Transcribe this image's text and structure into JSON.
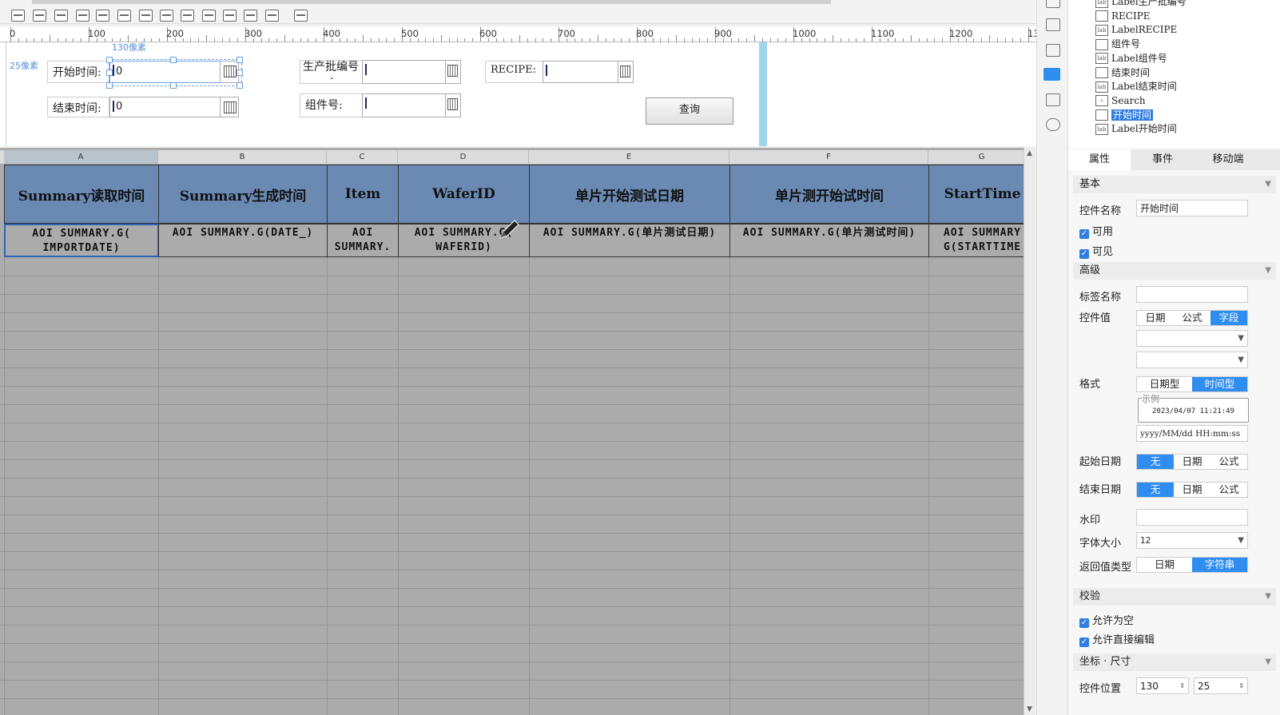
{
  "ruler": {
    "labels": [
      "0",
      "100",
      "200",
      "300",
      "400",
      "500",
      "600",
      "700",
      "800",
      "900",
      "1000",
      "1100",
      "1200",
      "13"
    ]
  },
  "canvas": {
    "hint_x": "130像素",
    "hint_y": "25像素",
    "start_label": "开始时间:",
    "start_value": "0",
    "end_label": "结束时间:",
    "end_value": "0",
    "batch_label": "生产批编号",
    "batch_dot": "·",
    "part_label": "组件号:",
    "recipe_label": "RECIPE:",
    "query_button": "查询"
  },
  "sheet": {
    "columns": [
      {
        "letter": "A",
        "header": "Summary读取时间",
        "cell": "AOI SUMMARY.G( IMPORTDATE)"
      },
      {
        "letter": "B",
        "header": "Summary生成时间",
        "cell": "AOI SUMMARY.G(DATE_)"
      },
      {
        "letter": "C",
        "header": "Item",
        "cell": "AOI SUMMARY."
      },
      {
        "letter": "D",
        "header": "WaferID",
        "cell": "AOI SUMMARY.G( WAFERID)"
      },
      {
        "letter": "E",
        "header": "单片开始测试日期",
        "cell": "AOI SUMMARY.G(单片测试日期)"
      },
      {
        "letter": "F",
        "header": "单片测开始试时间",
        "cell": "AOI SUMMARY.G(单片测试时间)"
      },
      {
        "letter": "G",
        "header": "StartTime",
        "cell": "AOI SUMMARY G(STARTTIME"
      }
    ],
    "splitter": "···"
  },
  "tree": {
    "nodes": [
      {
        "label": "Label生产批编号",
        "icon": "lab"
      },
      {
        "label": "RECIPE",
        "icon": "input"
      },
      {
        "label": "LabelRECIPE",
        "icon": "lab"
      },
      {
        "label": "组件号",
        "icon": "input"
      },
      {
        "label": "Label组件号",
        "icon": "lab"
      },
      {
        "label": "结束时间",
        "icon": "date"
      },
      {
        "label": "Label结束时间",
        "icon": "lab"
      },
      {
        "label": "Search",
        "icon": "search"
      },
      {
        "label": "开始时间",
        "icon": "date",
        "selected": true
      },
      {
        "label": "Label开始时间",
        "icon": "lab"
      }
    ]
  },
  "props": {
    "tabs": [
      "属性",
      "事件",
      "移动端"
    ],
    "sec_basic": "基本",
    "name_label": "控件名称",
    "name_value": "开始时间",
    "enabled": "可用",
    "visible": "可见",
    "sec_advanced": "高级",
    "tag_label": "标签名称",
    "value_label": "控件值",
    "value_modes": [
      "日期",
      "公式",
      "字段"
    ],
    "format_label": "格式",
    "format_modes": [
      "日期型",
      "时间型"
    ],
    "example_title": "示例",
    "example_value": "2023/04/07 11:21:49",
    "format_pattern": "yyyy/MM/dd HH:mm:ss",
    "start_date_label": "起始日期",
    "end_date_label": "结束日期",
    "range_modes": [
      "无",
      "日期",
      "公式"
    ],
    "watermark_label": "水印",
    "fontsize_label": "字体大小",
    "fontsize_value": "12",
    "return_label": "返回值类型",
    "return_modes": [
      "日期",
      "字符串"
    ],
    "sec_validate": "校验",
    "allow_empty": "允许为空",
    "allow_edit": "允许直接编辑",
    "sec_coords": "坐标 · 尺寸",
    "pos_label": "控件位置",
    "pos_x": "130",
    "pos_y": "25"
  }
}
